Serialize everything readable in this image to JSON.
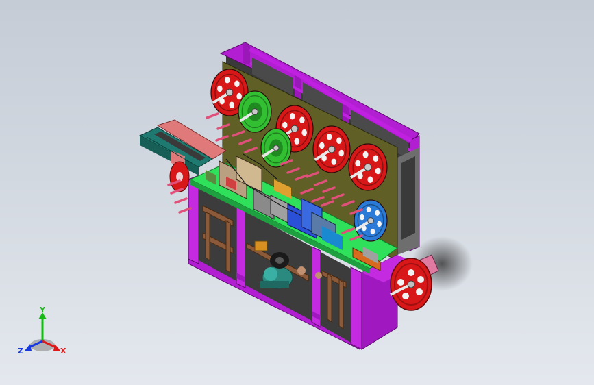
{
  "viewport": {
    "background_top": "#c6ccd6",
    "background_bottom": "#e4e8ee"
  },
  "model": {
    "description_icon": "cad-machine-assembly",
    "colors": {
      "frame_purple": "#b21ed2",
      "frame_purple_dark": "#7a1294",
      "back_plate": "#5a5a24",
      "table_green": "#2ee05a",
      "reel_red": "#d81818",
      "reel_green": "#32c032",
      "reel_blue": "#2a7ad8",
      "support_brown": "#8a5a3a",
      "rail_teal": "#1e7a70",
      "rail_pink": "#e07a7a",
      "motor_teal": "#2a8a80",
      "pin_pink": "#e0507a"
    }
  },
  "triad": {
    "x_label": "X",
    "y_label": "Y",
    "z_label": "Z",
    "x_color": "#e01818",
    "y_color": "#18b818",
    "z_color": "#1838e0"
  }
}
